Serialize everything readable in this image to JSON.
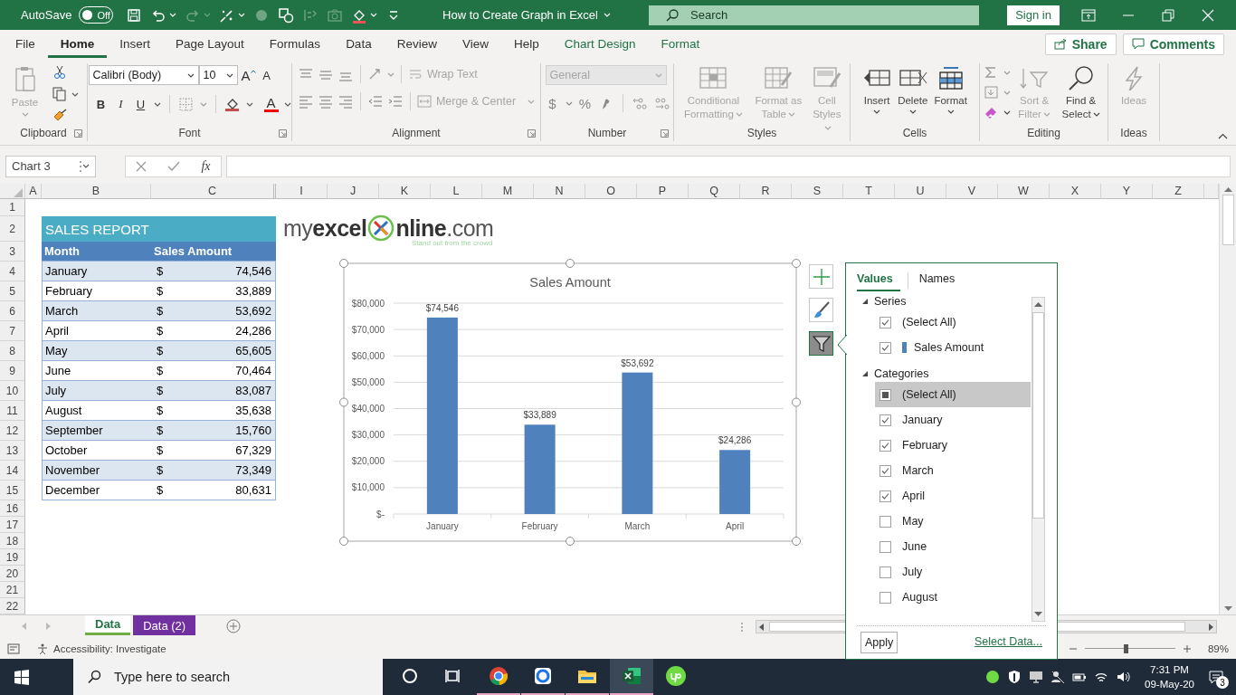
{
  "title_bar": {
    "autosave": {
      "label": "AutoSave",
      "on": false,
      "state_text": "Off"
    },
    "quick_access": [
      {
        "kind": "save",
        "disabled": false
      },
      {
        "kind": "undo",
        "disabled": false
      },
      {
        "kind": "redo",
        "disabled": true
      },
      {
        "kind": "draw",
        "disabled": false
      },
      {
        "kind": "record",
        "disabled": true
      },
      {
        "kind": "shapes",
        "disabled": false
      },
      {
        "kind": "align",
        "disabled": true
      },
      {
        "kind": "camera",
        "disabled": true
      },
      {
        "kind": "fill",
        "disabled": false
      },
      {
        "kind": "customize",
        "disabled": false
      }
    ],
    "document_title": "How to Create Graph in Excel",
    "search": {
      "placeholder": "Search"
    },
    "sign_in": "Sign in"
  },
  "menu_tabs": [
    {
      "label": "File",
      "selected": false,
      "kind": "standard"
    },
    {
      "label": "Home",
      "selected": true,
      "kind": "standard"
    },
    {
      "label": "Insert",
      "selected": false,
      "kind": "standard"
    },
    {
      "label": "Page Layout",
      "selected": false,
      "kind": "standard"
    },
    {
      "label": "Formulas",
      "selected": false,
      "kind": "standard"
    },
    {
      "label": "Data",
      "selected": false,
      "kind": "standard"
    },
    {
      "label": "Review",
      "selected": false,
      "kind": "standard"
    },
    {
      "label": "View",
      "selected": false,
      "kind": "standard"
    },
    {
      "label": "Help",
      "selected": false,
      "kind": "standard"
    },
    {
      "label": "Chart Design",
      "selected": false,
      "kind": "contextual"
    },
    {
      "label": "Format",
      "selected": false,
      "kind": "contextual"
    }
  ],
  "share": "Share",
  "comments": "Comments",
  "ribbon": {
    "clipboard": {
      "label": "Clipboard",
      "paste": {
        "label": "Paste",
        "disabled": true
      }
    },
    "font": {
      "label": "Font",
      "font_name": "Calibri (Body)",
      "font_size": "10",
      "grow": "A",
      "shrink": "A",
      "bold": "B",
      "italic": "I",
      "underline": "U",
      "font_color": "A"
    },
    "alignment": {
      "label": "Alignment",
      "wrap_text": {
        "label": "Wrap Text",
        "disabled": true
      },
      "merge_center": {
        "label": "Merge & Center",
        "disabled": true
      }
    },
    "number": {
      "label": "Number",
      "format": {
        "value": "General",
        "disabled": true
      },
      "currency": "$",
      "percent": "%"
    },
    "styles": {
      "label": "Styles",
      "buttons": [
        {
          "kind": "conditional",
          "label": "Conditional Formatting",
          "disabled": true
        },
        {
          "kind": "table",
          "label": "Format as Table",
          "disabled": true
        },
        {
          "kind": "cell_styles",
          "label": "Cell Styles",
          "disabled": true
        }
      ]
    },
    "cells": {
      "label": "Cells",
      "buttons": [
        {
          "kind": "insert",
          "label": "Insert",
          "disabled": false
        },
        {
          "kind": "delete",
          "label": "Delete",
          "disabled": false
        },
        {
          "kind": "format",
          "label": "Format",
          "disabled": false
        }
      ]
    },
    "editing": {
      "label": "Editing",
      "buttons": [
        {
          "kind": "sort_filter",
          "label": "Sort & Filter",
          "disabled": true
        },
        {
          "kind": "find_select",
          "label": "Find & Select",
          "disabled": false
        }
      ]
    },
    "ideas": {
      "label": "Ideas",
      "buttons": [
        {
          "kind": "ideas",
          "label": "Ideas",
          "disabled": true
        }
      ]
    }
  },
  "formula_bar": {
    "name_box": "Chart 3",
    "function_label": "fx"
  },
  "sheet": {
    "columns": [
      "A",
      "B",
      "C",
      "I",
      "J",
      "K",
      "L",
      "M",
      "N",
      "O",
      "P",
      "Q",
      "R",
      "S",
      "T",
      "U",
      "V",
      "W",
      "X",
      "Y",
      "Z"
    ],
    "rows": [
      "1",
      "2",
      "3",
      "4",
      "5",
      "6",
      "7",
      "8",
      "9",
      "10",
      "11",
      "12",
      "13",
      "14",
      "15",
      "16",
      "17",
      "18",
      "19",
      "20",
      "21",
      "22"
    ],
    "report": {
      "title": "SALES REPORT",
      "headers": [
        "Month",
        "Sales Amount"
      ],
      "rows": [
        {
          "month": "January",
          "currency": "$",
          "amount": "74,546"
        },
        {
          "month": "February",
          "currency": "$",
          "amount": "33,889"
        },
        {
          "month": "March",
          "currency": "$",
          "amount": "53,692"
        },
        {
          "month": "April",
          "currency": "$",
          "amount": "24,286"
        },
        {
          "month": "May",
          "currency": "$",
          "amount": "65,605"
        },
        {
          "month": "June",
          "currency": "$",
          "amount": "70,464"
        },
        {
          "month": "July",
          "currency": "$",
          "amount": "83,087"
        },
        {
          "month": "August",
          "currency": "$",
          "amount": "35,638"
        },
        {
          "month": "September",
          "currency": "$",
          "amount": "15,760"
        },
        {
          "month": "October",
          "currency": "$",
          "amount": "67,329"
        },
        {
          "month": "November",
          "currency": "$",
          "amount": "73,349"
        },
        {
          "month": "December",
          "currency": "$",
          "amount": "80,631"
        }
      ]
    },
    "logo": {
      "prefix": "my",
      "brand": "excel",
      "middle": "nline",
      "suffix": ".com",
      "tagline": "Stand out from the crowd"
    }
  },
  "chart": {
    "chart_data": {
      "type": "bar",
      "title": "Sales Amount",
      "categories": [
        "January",
        "February",
        "March",
        "April"
      ],
      "series": [
        {
          "color": "#4f81bd",
          "values": [
            74546,
            33889,
            53692,
            24286
          ]
        }
      ],
      "ylim": [
        0,
        80000
      ],
      "grid": true,
      "yticks": [
        {
          "value": 0,
          "label": "$-"
        },
        {
          "value": 10000,
          "label": "$10,000"
        },
        {
          "value": 20000,
          "label": "$20,000"
        },
        {
          "value": 30000,
          "label": "$30,000"
        },
        {
          "value": 40000,
          "label": "$40,000"
        },
        {
          "value": 50000,
          "label": "$50,000"
        },
        {
          "value": 60000,
          "label": "$60,000"
        },
        {
          "value": 70000,
          "label": "$70,000"
        },
        {
          "value": 80000,
          "label": "$80,000"
        }
      ],
      "value_labels": [
        "$74,546",
        "$33,889",
        "$53,692",
        "$24,286"
      ]
    },
    "side_buttons": [
      {
        "kind": "elements",
        "selected": false
      },
      {
        "kind": "styles",
        "selected": false
      },
      {
        "kind": "filter",
        "selected": true
      }
    ]
  },
  "filter_panel": {
    "tabs": [
      {
        "label": "Values",
        "selected": true
      },
      {
        "label": "Names",
        "selected": false
      }
    ],
    "sections": [
      {
        "label": "Series",
        "expanded": true,
        "items": [
          {
            "label": "(Select All)",
            "kind": "plain",
            "checked": true,
            "indeterminate": false,
            "highlighted": false
          },
          {
            "label": "Sales Amount",
            "kind": "swatch",
            "color": "#4f81bd",
            "checked": true,
            "indeterminate": false,
            "highlighted": false
          }
        ]
      },
      {
        "label": "Categories",
        "expanded": true,
        "items": [
          {
            "label": "(Select All)",
            "kind": "plain",
            "checked": false,
            "indeterminate": true,
            "highlighted": true
          },
          {
            "label": "January",
            "kind": "plain",
            "checked": true,
            "indeterminate": false,
            "highlighted": false
          },
          {
            "label": "February",
            "kind": "plain",
            "checked": true,
            "indeterminate": false,
            "highlighted": false
          },
          {
            "label": "March",
            "kind": "plain",
            "checked": true,
            "indeterminate": false,
            "highlighted": false
          },
          {
            "label": "April",
            "kind": "plain",
            "checked": true,
            "indeterminate": false,
            "highlighted": false
          },
          {
            "label": "May",
            "kind": "plain",
            "checked": false,
            "indeterminate": false,
            "highlighted": false
          },
          {
            "label": "June",
            "kind": "plain",
            "checked": false,
            "indeterminate": false,
            "highlighted": false
          },
          {
            "label": "July",
            "kind": "plain",
            "checked": false,
            "indeterminate": false,
            "highlighted": false
          },
          {
            "label": "August",
            "kind": "plain",
            "checked": false,
            "indeterminate": false,
            "highlighted": false
          }
        ]
      }
    ],
    "apply": "Apply",
    "select_data": "Select Data..."
  },
  "sheet_tabs": [
    {
      "label": "Data",
      "selected": true,
      "color": "#70ad47"
    },
    {
      "label": "Data (2)",
      "selected": false,
      "color": "#7030a0"
    }
  ],
  "status_bar": {
    "accessibility": "Accessibility: Investigate",
    "zoom": {
      "level": 0.45,
      "reading": "89%"
    }
  },
  "taskbar": {
    "search": {
      "placeholder": "Type here to search"
    },
    "apps": [
      {
        "kind": "cortana",
        "running": false,
        "active": false
      },
      {
        "kind": "task_view",
        "running": false,
        "active": false
      },
      {
        "kind": "chrome",
        "running": true,
        "active": false
      },
      {
        "kind": "blue_app",
        "running": true,
        "active": false
      },
      {
        "kind": "explorer",
        "running": true,
        "active": false
      },
      {
        "kind": "excel",
        "running": true,
        "active": true
      },
      {
        "kind": "upwork",
        "running": false,
        "active": false
      }
    ],
    "time": "7:31 PM",
    "date": "09-May-20",
    "notifications": "3"
  }
}
